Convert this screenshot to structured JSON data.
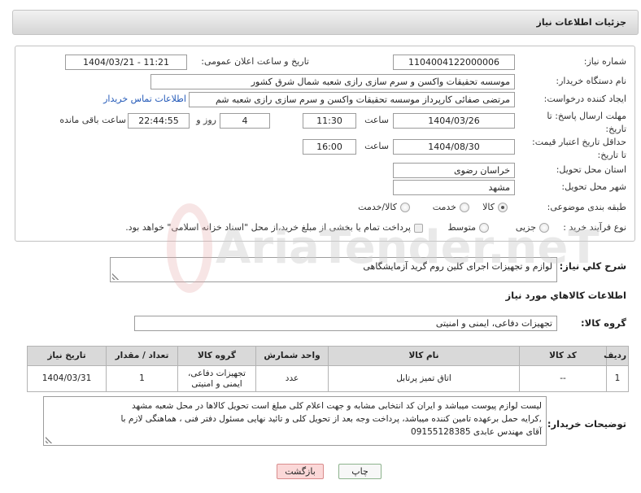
{
  "header": {
    "title": "جزئیات اطلاعات نیاز"
  },
  "form": {
    "need_number": {
      "label": "شماره نیاز:",
      "value": "1104004122000006"
    },
    "announce": {
      "label": "تاریخ و ساعت اعلان عمومی:",
      "value": "1404/03/21 - 11:21"
    },
    "buyer_org": {
      "label": "نام دستگاه خریدار:",
      "value": "موسسه تحقیقات واکسن و سرم سازی رازی شعبه شمال شرق کشور"
    },
    "requester": {
      "label": "ایجاد کننده درخواست:",
      "value": "مرتضی صفائی کارپرداز موسسه تحقیقات واکسن و سرم سازی رازی شعبه شم",
      "contact_link": "اطلاعات تماس خریدار"
    },
    "deadline": {
      "label_line1": "مهلت ارسال پاسخ: تا",
      "label_line2": "تاریخ:",
      "date": "1404/03/26",
      "time_label": "ساعت",
      "time": "11:30",
      "days": "4",
      "days_label": "روز و",
      "remaining": "22:44:55",
      "remaining_label": "ساعت باقی مانده"
    },
    "validity": {
      "label_line1": "حداقل تاریخ اعتبار قیمت:",
      "label_line2": "تا تاریخ:",
      "date": "1404/08/30",
      "time_label": "ساعت",
      "time": "16:00"
    },
    "province": {
      "label": "استان محل تحویل:",
      "value": "خراسان رضوی"
    },
    "city": {
      "label": "شهر محل تحویل:",
      "value": "مشهد"
    },
    "category": {
      "label": "طبقه بندی موضوعی:",
      "options": [
        {
          "label": "کالا",
          "selected": true
        },
        {
          "label": "خدمت",
          "selected": false
        },
        {
          "label": "کالا/خدمت",
          "selected": false
        }
      ]
    },
    "process": {
      "label": "نوع فرآیند خرید :",
      "options": [
        {
          "label": "جزیی",
          "selected": false
        },
        {
          "label": "متوسط",
          "selected": false
        }
      ],
      "treasury": {
        "label": "پرداخت تمام یا بخشی از مبلغ خرید،از محل \"اسناد خزانه اسلامی\" خواهد بود.",
        "checked": false
      }
    }
  },
  "watermark": {
    "text": "AriaTender.neT"
  },
  "description": {
    "label": "شرح کلي نياز:",
    "value": "لوازم و تجهیزات اجرای کلین روم گرید آزمایشگاهی"
  },
  "goods": {
    "heading": "اطلاعات کالاهاي مورد نياز",
    "group_label": "گروه کالا:",
    "group_value": "تجهیزات دفاعی، ایمنی و امنیتی",
    "columns": [
      "ردیف",
      "کد کالا",
      "نام کالا",
      "واحد شمارش",
      "گروه کالا",
      "تعداد / مقدار",
      "تاریخ نیاز"
    ],
    "rows": [
      [
        "1",
        "--",
        "اتاق تمیز پرتابل",
        "عدد",
        "تجهیزات دفاعی، ایمنی و امنیتی",
        "1",
        "1404/03/31"
      ]
    ]
  },
  "buyer_notes": {
    "label": "توضیحات خریدار:",
    "lines": [
      "لیست لوازم پیوست میباشد و ایران کد انتخابی مشابه و جهت اعلام کلی مبلغ است تحویل کالاها در محل شعبه مشهد",
      ",کرایه حمل برعهده تامین کننده میباشد، پرداخت وجه بعد از تحویل کلی و تائید نهایی مسئول دفتر فنی ، هماهنگی لازم با",
      "آقای مهندس عابدی 09155128385"
    ]
  },
  "actions": {
    "print": "چاپ",
    "back": "بازگشت"
  },
  "colors": {
    "link": "#2359b8",
    "header_top": "#f2f2f2",
    "header_bottom": "#d5d5d5",
    "table_header_bg": "#d9d9d9",
    "print_button_bg": "#f7f7f7",
    "print_button_border": "#8db38d",
    "back_button_bg": "#fbd8d8",
    "back_button_border": "#d98c8c",
    "watermark_text": "#cfcfcf",
    "watermark_logo": "#e6a9a9"
  }
}
